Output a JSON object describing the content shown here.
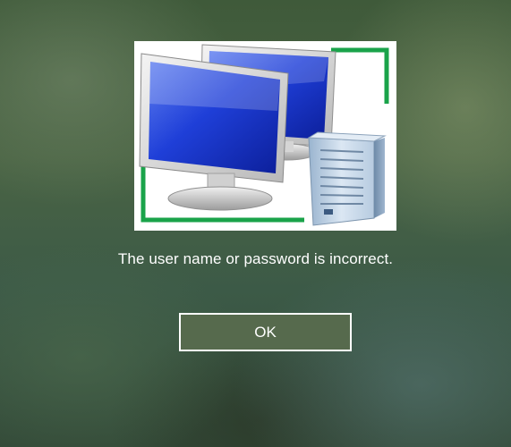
{
  "dialog": {
    "icon": "network-computers-server-icon",
    "message": "The user name or password is incorrect.",
    "ok_label": "OK"
  },
  "colors": {
    "button_fill": "#566a4d",
    "button_border": "#ffffff",
    "text": "#ffffff",
    "icon_frame_green": "#1aa34a",
    "monitor_blue": "#1a33c7"
  }
}
